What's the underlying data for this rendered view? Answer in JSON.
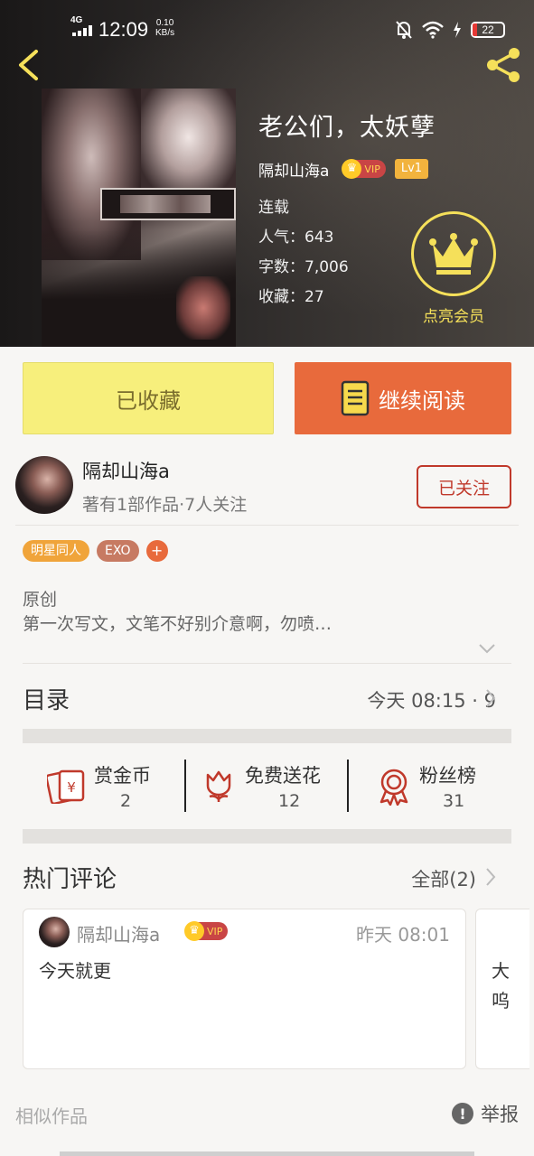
{
  "status_bar": {
    "network": "4G",
    "time": "12:09",
    "speed_value": "0.10",
    "speed_unit": "KB/s",
    "battery": "22"
  },
  "book": {
    "title": "老公们，太妖孽",
    "author": "隔却山海a",
    "vip_label": "VIP",
    "level": "Lv1",
    "status": "连载",
    "popularity": "人气：643",
    "word_count": "字数：7,006",
    "favorites": "收藏：27",
    "member_label": "点亮会员"
  },
  "actions": {
    "favorited_label": "已收藏",
    "continue_label": "继续阅读"
  },
  "author_card": {
    "name": "隔却山海a",
    "subtitle": "著有1部作品·7人关注",
    "follow_label": "已关注"
  },
  "tags": [
    "明星同人",
    "EXO",
    "+"
  ],
  "description": {
    "type": "原创",
    "text": "第一次写文，文笔不好别介意啊，勿喷…"
  },
  "toc": {
    "label": "目录",
    "latest": "今天 08:15 · 9"
  },
  "stats": [
    {
      "label": "赏金币",
      "value": "2"
    },
    {
      "label": "免费送花",
      "value": "12"
    },
    {
      "label": "粉丝榜",
      "value": "31"
    }
  ],
  "comments": {
    "label": "热门评论",
    "all_label": "全部(2)",
    "items": [
      {
        "user": "隔却山海a",
        "vip": "VIP",
        "time": "昨天 08:01",
        "text": "今天就更"
      },
      {
        "text_line1": "大",
        "text_line2": "呜"
      }
    ]
  },
  "footer": {
    "similar": "相似作品",
    "report": "举报",
    "report_icon": "!"
  },
  "colors": {
    "accent_orange": "#e86a3c",
    "favorite_yellow": "#f7ef7c",
    "follow_red": "#c0392b",
    "member_gold": "#f5e05a"
  }
}
